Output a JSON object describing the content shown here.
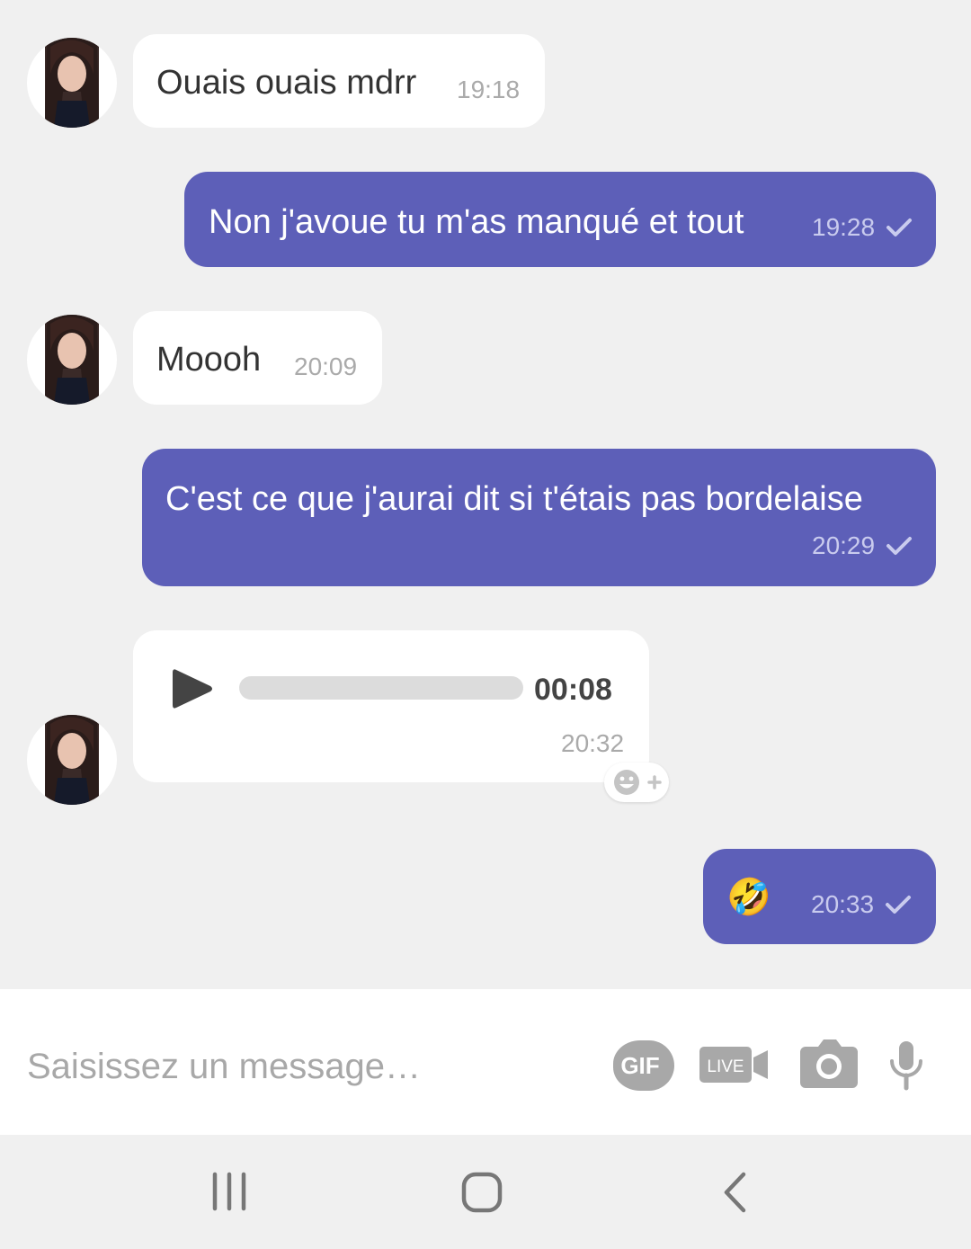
{
  "messages": [
    {
      "direction": "incoming",
      "text": "Ouais ouais mdrr",
      "time": "19:18"
    },
    {
      "direction": "outgoing",
      "text": "Non j'avoue tu m'as manqué et tout",
      "time": "19:28",
      "status": "sent"
    },
    {
      "direction": "incoming",
      "text": "Moooh",
      "time": "20:09"
    },
    {
      "direction": "outgoing",
      "text": "C'est ce que j'aurai dit si t'étais pas bordelaise",
      "time": "20:29",
      "status": "sent"
    },
    {
      "direction": "incoming",
      "type": "voice",
      "duration": "00:08",
      "time": "20:32",
      "progress": 0
    },
    {
      "direction": "outgoing",
      "text": "🤣",
      "time": "20:33",
      "status": "sent"
    }
  ],
  "composer": {
    "placeholder": "Saisissez un message…",
    "gif_label": "GIF",
    "live_label": "LIVE"
  },
  "icons": {
    "play": "play-icon",
    "reaction": "add-reaction-icon",
    "camera": "camera-icon",
    "microphone": "microphone-icon",
    "recents": "recent-apps-icon",
    "home": "home-icon",
    "back": "back-icon"
  },
  "colors": {
    "outgoing_bubble": "#5d5fb8",
    "incoming_bubble": "#ffffff",
    "background": "#f0f0f0"
  }
}
